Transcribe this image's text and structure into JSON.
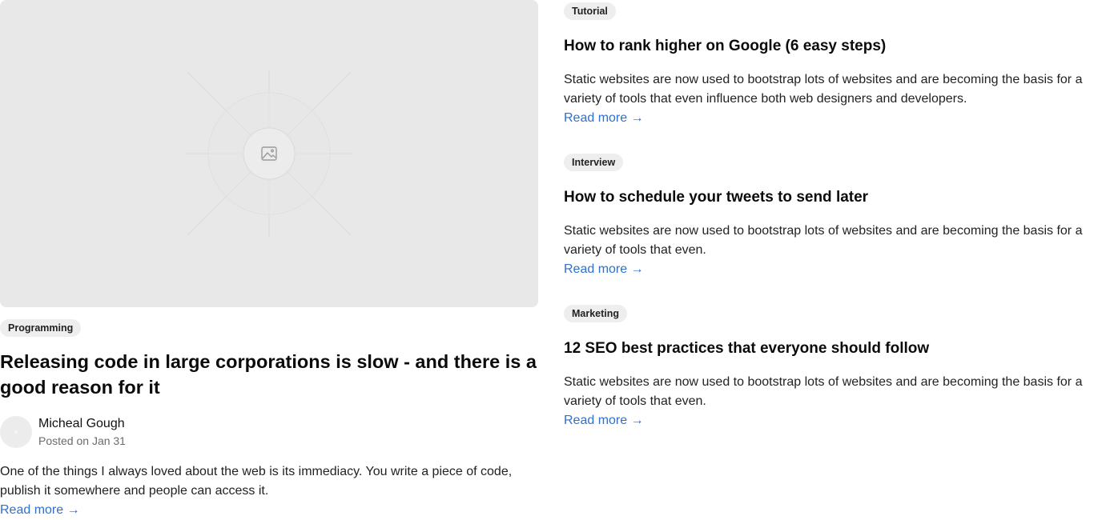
{
  "featured": {
    "image_icon": "image-placeholder-icon",
    "tag": "Programming",
    "title": "Releasing code in large corporations is slow - and there is a good reason for it",
    "author_name": "Micheal Gough",
    "posted": "Posted on Jan 31",
    "excerpt": "One of the things I always loved about the web is its immediacy. You write a piece of code, publish it somewhere and people can access it.",
    "read_more": "Read more →"
  },
  "posts": [
    {
      "tag": "Tutorial",
      "title": "How to rank higher on Google (6 easy steps)",
      "excerpt": "Static websites are now used to bootstrap lots of websites and are becoming the basis for a variety of tools that even influence both web designers and developers.",
      "read_more": "Read more →"
    },
    {
      "tag": "Interview",
      "title": "How to schedule your tweets to send later",
      "excerpt": "Static websites are now used to bootstrap lots of websites and are becoming the basis for a variety of tools that even.",
      "read_more": "Read more →"
    },
    {
      "tag": "Marketing",
      "title": "12 SEO best practices that everyone should follow",
      "excerpt": "Static websites are now used to bootstrap lots of websites and are becoming the basis for a variety of tools that even.",
      "read_more": "Read more →"
    }
  ],
  "colors": {
    "link": "#2f6fce",
    "tag_bg": "#eeeeee",
    "image_bg": "#e8e8e8"
  }
}
